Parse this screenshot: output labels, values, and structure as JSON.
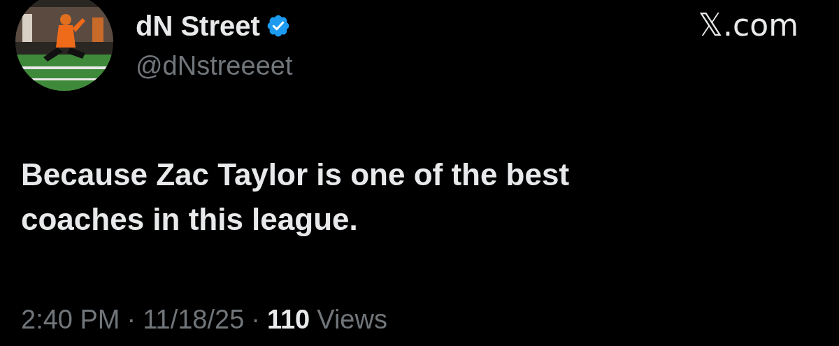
{
  "author": {
    "name": "dN Street",
    "verified": true,
    "handle": "@dNstreeeet"
  },
  "site_label": "𝕏.com",
  "text": [
    "Because Zac Taylor is one of the best",
    "coaches in this league."
  ],
  "meta": [
    {
      "kind": "time",
      "text": "2:40 PM"
    },
    {
      "kind": "separator",
      "text": "·"
    },
    {
      "kind": "date",
      "text": "11/18/25"
    },
    {
      "kind": "separator",
      "text": "·"
    },
    {
      "kind": "count",
      "text": "110"
    },
    {
      "kind": "label",
      "text": "Views"
    }
  ]
}
